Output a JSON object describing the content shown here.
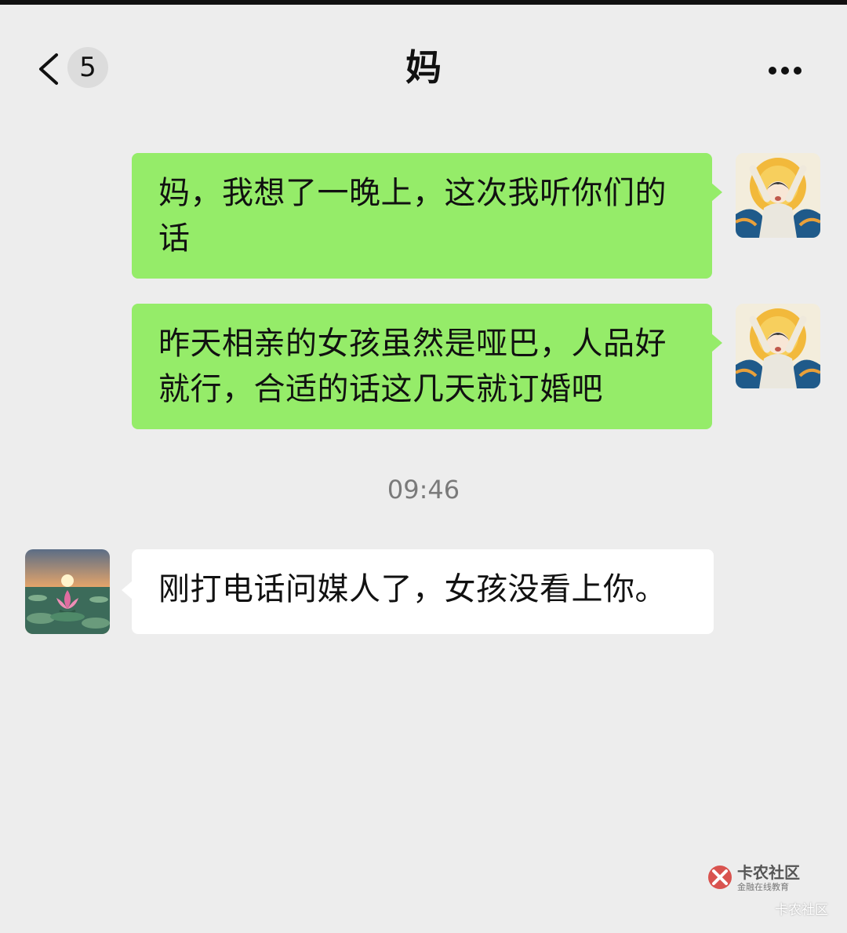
{
  "header": {
    "back_icon": "chevron-left-icon",
    "unread_count": "5",
    "title": "妈",
    "more_icon": "more-dots-icon"
  },
  "messages": [
    {
      "side": "sent",
      "text": "妈，我想了一晚上，这次我听你们的话"
    },
    {
      "side": "sent",
      "text": "昨天相亲的女孩虽然是哑巴，人品好就行，合适的话这几天就订婚吧"
    },
    {
      "side": "received",
      "text": "刚打电话问媒人了，女孩没看上你。"
    }
  ],
  "timestamp": "09:46",
  "watermark": {
    "brand": "卡农社区",
    "tagline": "金融在线教育",
    "corner": "卡农社区"
  },
  "colors": {
    "background": "#ededed",
    "sent_bubble": "#95ec69",
    "received_bubble": "#ffffff",
    "timestamp": "#7a7a7a"
  }
}
